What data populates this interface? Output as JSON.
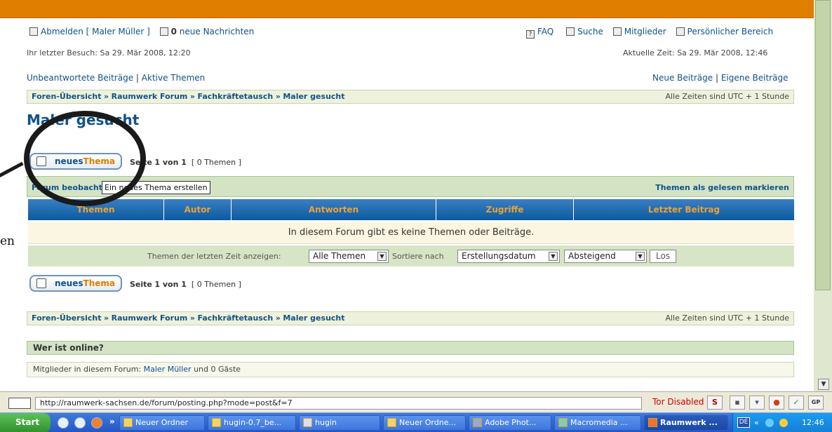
{
  "header": {
    "logout_label": "Abmelden [ Maler Müller ]",
    "messages_count": "0",
    "messages_label": "neue Nachrichten",
    "faq": "FAQ",
    "search": "Suche",
    "members": "Mitglieder",
    "personal": "Persönlicher Bereich",
    "last_visit": "Ihr letzter Besuch: Sa 29. Mär 2008, 12:20",
    "current_time": "Aktuelle Zeit: Sa 29. Mär 2008, 12:46",
    "unanswered": "Unbeantwortete Beiträge",
    "active": "Aktive Themen",
    "new_posts": "Neue Beiträge",
    "own_posts": "Eigene Beiträge",
    "sep": "|"
  },
  "breadcrumb": {
    "items": [
      "Foren-Übersicht",
      "Raumwerk Forum",
      "Fachkräftetausch",
      "Maler gesucht"
    ],
    "sep": "»",
    "timezone": "Alle Zeiten sind UTC + 1 Stunde"
  },
  "forum": {
    "title": "Maler gesucht",
    "new_topic_prefix": "neues",
    "new_topic_suffix": "Thema",
    "page_prefix": "Seite",
    "page_info": "1 von 1",
    "topic_count": "[ 0 Themen ]",
    "watch": "Forum beobachten",
    "mark_read": "Themen als gelesen markieren",
    "tooltip": "Ein neues Thema erstellen",
    "columns": [
      "Themen",
      "Autor",
      "Antworten",
      "Zugriffe",
      "Letzter Beitrag"
    ],
    "empty_message": "In diesem Forum gibt es keine Themen oder Beiträge.",
    "filter_label": "Themen der letzten Zeit anzeigen:",
    "filter_value": "Alle Themen",
    "sort_label": "Sortiere nach",
    "sort_value": "Erstellungsdatum",
    "order_value": "Absteigend",
    "go": "Los",
    "left_glyph": "en"
  },
  "online": {
    "title": "Wer ist online?",
    "prefix": "Mitglieder in diesem Forum:",
    "member": "Maler Müller",
    "suffix": "und 0 Gäste"
  },
  "statusbar": {
    "url": "http://raumwerk-sachsen.de/forum/posting.php?mode=post&f=7",
    "tor": "Tor Disabled",
    "s_label": "S"
  },
  "taskbar": {
    "start": "Start",
    "more": "»",
    "tasks": [
      "Neuer Ordner",
      "hugin-0.7_be...",
      "hugin",
      "Neuer Ordne...",
      "Adobe Phot...",
      "Macromedia ...",
      "Raumwerk ..."
    ],
    "tray_label": "DE",
    "tray_more": "«",
    "clock": "12:46"
  },
  "colors": {
    "accent": "#e07e00",
    "link": "#105289",
    "table_header": "#0b5aa0"
  }
}
